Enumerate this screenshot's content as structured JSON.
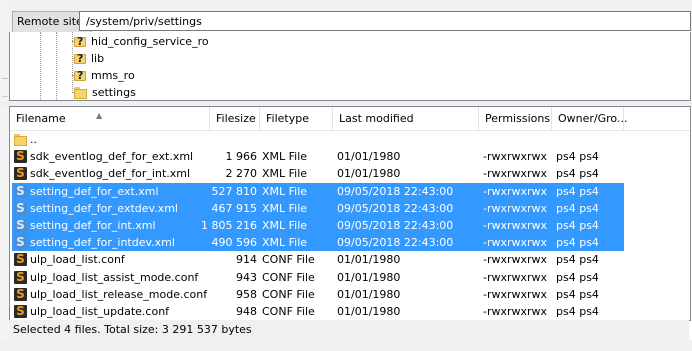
{
  "remote_site": {
    "label": "Remote site:",
    "path": "/system/priv/settings"
  },
  "tree": {
    "items": [
      {
        "name": "hid_config_service_ro",
        "icon": "unknown-folder-icon"
      },
      {
        "name": "lib",
        "icon": "unknown-folder-icon"
      },
      {
        "name": "mms_ro",
        "icon": "unknown-folder-icon"
      },
      {
        "name": "settings",
        "icon": "folder-icon"
      }
    ]
  },
  "columns": {
    "filename": "Filename",
    "filesize": "Filesize",
    "filetype": "Filetype",
    "last_modified": "Last modified",
    "permissions": "Permissions",
    "owner": "Owner/Gro..."
  },
  "files": [
    {
      "name": "..",
      "size": "",
      "type": "",
      "modified": "",
      "perms": "",
      "owner": "",
      "icon": "folder-icon",
      "selected": false
    },
    {
      "name": "sdk_eventlog_def_for_ext.xml",
      "size": "1 966",
      "type": "XML File",
      "modified": "01/01/1980",
      "perms": "-rwxrwxrwx",
      "owner": "ps4 ps4",
      "icon": "sublime-file-icon",
      "selected": false
    },
    {
      "name": "sdk_eventlog_def_for_int.xml",
      "size": "2 270",
      "type": "XML File",
      "modified": "01/01/1980",
      "perms": "-rwxrwxrwx",
      "owner": "ps4 ps4",
      "icon": "sublime-file-icon",
      "selected": false
    },
    {
      "name": "setting_def_for_ext.xml",
      "size": "527 810",
      "type": "XML File",
      "modified": "09/05/2018 22:43:00",
      "perms": "-rwxrwxrwx",
      "owner": "ps4 ps4",
      "icon": "sublime-file-icon",
      "selected": true
    },
    {
      "name": "setting_def_for_extdev.xml",
      "size": "467 915",
      "type": "XML File",
      "modified": "09/05/2018 22:43:00",
      "perms": "-rwxrwxrwx",
      "owner": "ps4 ps4",
      "icon": "sublime-file-icon",
      "selected": true
    },
    {
      "name": "setting_def_for_int.xml",
      "size": "1 805 216",
      "type": "XML File",
      "modified": "09/05/2018 22:43:00",
      "perms": "-rwxrwxrwx",
      "owner": "ps4 ps4",
      "icon": "sublime-file-icon",
      "selected": true
    },
    {
      "name": "setting_def_for_intdev.xml",
      "size": "490 596",
      "type": "XML File",
      "modified": "09/05/2018 22:43:00",
      "perms": "-rwxrwxrwx",
      "owner": "ps4 ps4",
      "icon": "sublime-file-icon",
      "selected": true
    },
    {
      "name": "ulp_load_list.conf",
      "size": "914",
      "type": "CONF File",
      "modified": "01/01/1980",
      "perms": "-rwxrwxrwx",
      "owner": "ps4 ps4",
      "icon": "sublime-file-icon",
      "selected": false
    },
    {
      "name": "ulp_load_list_assist_mode.conf",
      "size": "943",
      "type": "CONF File",
      "modified": "01/01/1980",
      "perms": "-rwxrwxrwx",
      "owner": "ps4 ps4",
      "icon": "sublime-file-icon",
      "selected": false
    },
    {
      "name": "ulp_load_list_release_mode.conf",
      "size": "958",
      "type": "CONF File",
      "modified": "01/01/1980",
      "perms": "-rwxrwxrwx",
      "owner": "ps4 ps4",
      "icon": "sublime-file-icon",
      "selected": false
    },
    {
      "name": "ulp_load_list_update.conf",
      "size": "948",
      "type": "CONF File",
      "modified": "01/01/1980",
      "perms": "-rwxrwxrwx",
      "owner": "ps4 ps4",
      "icon": "sublime-file-icon",
      "selected": false
    }
  ],
  "status": "Selected 4 files. Total size: 3 291 537 bytes",
  "colors": {
    "selection": "#3399ff",
    "selection_text": "#ffffff"
  }
}
